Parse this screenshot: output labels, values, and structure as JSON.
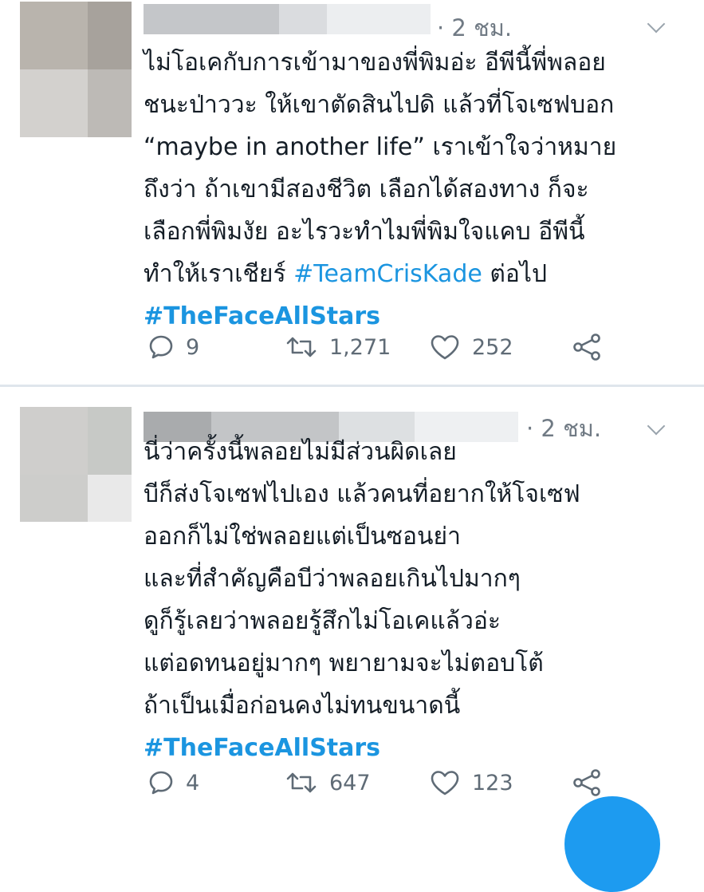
{
  "tweets": [
    {
      "time": "· 2 ชม.",
      "lines": [
        "ไม่โอเคกับการเข้ามาของพี่พิมอ่ะ อีพีนี้พี่พลอย",
        "ชนะป่าววะ ให้เขาตัดสินไปดิ แล้วที่โจเซฟบอก",
        "“maybe in another life” เราเข้าใจว่าหมาย",
        "ถึงว่า ถ้าเขามีสองชีวิต เลือกได้สองทาง ก็จะ",
        "เลือกพี่พิมงัย อะไรวะทำไมพี่พิมใจแคบ อีพีนี้"
      ],
      "line6_prefix": "ทำให้เราเชียร์ ",
      "inline_hashtag": "#TeamCrisKade",
      "line6_suffix": " ต่อไป",
      "hashtag": "#TheFaceAllStars",
      "replies": "9",
      "retweets": "1,271",
      "likes": "252"
    },
    {
      "time": "· 2 ชม.",
      "lines": [
        "นี่ว่าครั้งนี้พลอยไม่มีส่วนผิดเลย",
        "บีก็ส่งโจเซฟไปเอง แล้วคนที่อยากให้โจเซฟ",
        "ออกก็ไม่ใช่พลอยแต่เป็นซอนย่า",
        "และที่สำคัญคือบีว่าพลอยเกินไปมากๆ",
        "ดูก็รู้เลยว่าพลอยรู้สึกไม่โอเคแล้วอ่ะ",
        "แต่อดทนอยู่มากๆ พยายามจะไม่ตอบโต้",
        "ถ้าเป็นเมื่อก่อนคงไม่ทนขนาดนี้"
      ],
      "hashtag": "#TheFaceAllStars",
      "replies": "4",
      "retweets": "647",
      "likes": "123"
    }
  ],
  "icons": {
    "reply": "reply-icon",
    "retweet": "retweet-icon",
    "like": "heart-icon",
    "share": "share-icon",
    "more": "chevron-down-icon"
  },
  "colors": {
    "hashtag": "#1b95e0",
    "meta": "#707a84",
    "text": "#141d26",
    "divider": "#dfe6ec",
    "fab": "#1d9bf0"
  }
}
